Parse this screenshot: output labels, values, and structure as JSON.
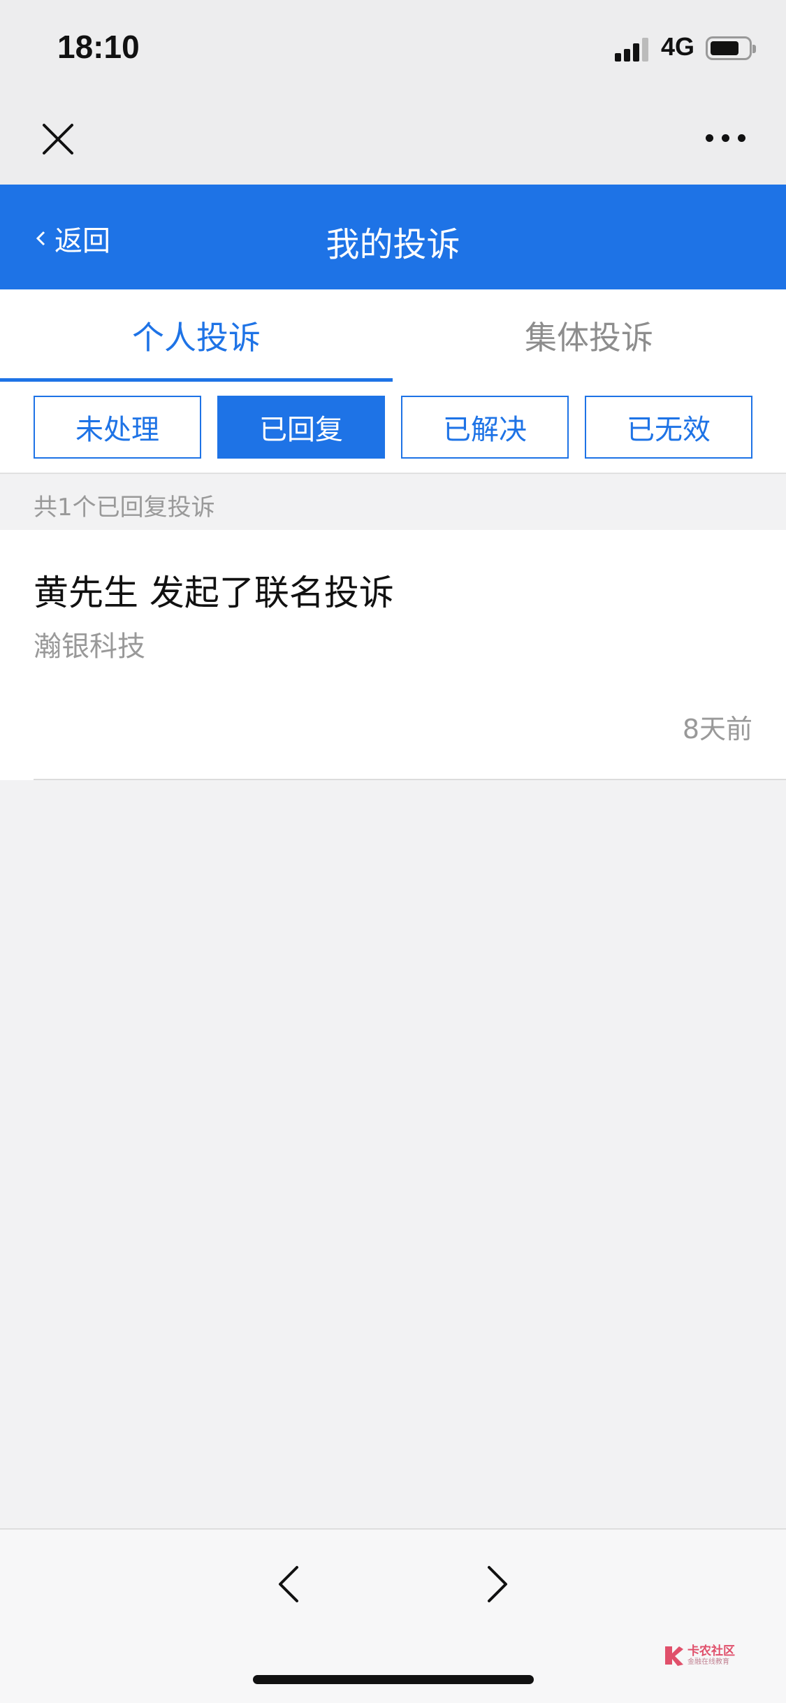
{
  "status_bar": {
    "time": "18:10",
    "network": "4G",
    "signal_bars": 3,
    "battery_level": 0.7
  },
  "webview": {
    "close_icon": "close-icon",
    "more_icon": "more-icon"
  },
  "header": {
    "back_label": "返回",
    "title": "我的投诉",
    "background_color": "#1e73e6"
  },
  "tabs": [
    {
      "label": "个人投诉",
      "active": true
    },
    {
      "label": "集体投诉",
      "active": false
    }
  ],
  "filters": [
    {
      "label": "未处理",
      "active": false
    },
    {
      "label": "已回复",
      "active": true
    },
    {
      "label": "已解决",
      "active": false
    },
    {
      "label": "已无效",
      "active": false
    }
  ],
  "count_text": "共1个已回复投诉",
  "complaints": [
    {
      "title": "黄先生 发起了联名投诉",
      "company": "瀚银科技",
      "time": "8天前"
    }
  ],
  "bottom_nav": {
    "back_icon": "chevron-left-icon",
    "forward_icon": "chevron-right-icon"
  },
  "watermark": {
    "title": "卡农社区",
    "subtitle": "金融在线教育"
  }
}
